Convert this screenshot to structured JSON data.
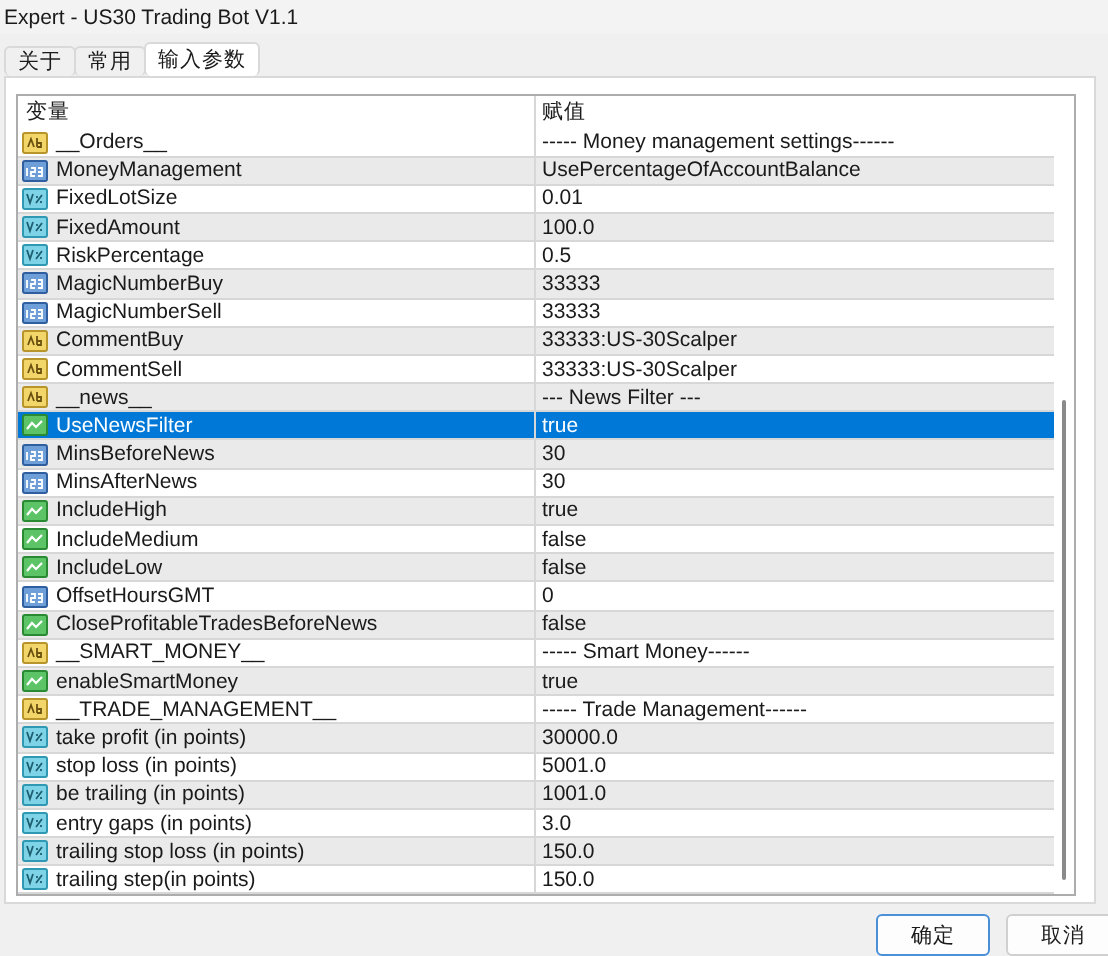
{
  "window": {
    "title": "Expert - US30 Trading Bot V1.1"
  },
  "tabs": [
    {
      "label": "关于",
      "selected": false
    },
    {
      "label": "常用",
      "selected": false
    },
    {
      "label": "输入参数",
      "selected": true
    }
  ],
  "table": {
    "columns": [
      "变量",
      "赋值"
    ],
    "rows": [
      {
        "kind": "string",
        "name": "__Orders__",
        "value": "----- Money management settings------",
        "selected": false
      },
      {
        "kind": "int",
        "name": "MoneyManagement",
        "value": "UsePercentageOfAccountBalance",
        "selected": false
      },
      {
        "kind": "double",
        "name": "FixedLotSize",
        "value": "0.01",
        "selected": false
      },
      {
        "kind": "double",
        "name": "FixedAmount",
        "value": "100.0",
        "selected": false
      },
      {
        "kind": "double",
        "name": "RiskPercentage",
        "value": "0.5",
        "selected": false
      },
      {
        "kind": "int",
        "name": "MagicNumberBuy",
        "value": "33333",
        "selected": false
      },
      {
        "kind": "int",
        "name": "MagicNumberSell",
        "value": "33333",
        "selected": false
      },
      {
        "kind": "string",
        "name": "CommentBuy",
        "value": "33333:US-30Scalper",
        "selected": false
      },
      {
        "kind": "string",
        "name": "CommentSell",
        "value": "33333:US-30Scalper",
        "selected": false
      },
      {
        "kind": "string",
        "name": "__news__",
        "value": "--- News Filter ---",
        "selected": false
      },
      {
        "kind": "bool",
        "name": "UseNewsFilter",
        "value": "true",
        "selected": true
      },
      {
        "kind": "int",
        "name": "MinsBeforeNews",
        "value": "30",
        "selected": false
      },
      {
        "kind": "int",
        "name": "MinsAfterNews",
        "value": "30",
        "selected": false
      },
      {
        "kind": "bool",
        "name": "IncludeHigh",
        "value": "true",
        "selected": false
      },
      {
        "kind": "bool",
        "name": "IncludeMedium",
        "value": "false",
        "selected": false
      },
      {
        "kind": "bool",
        "name": "IncludeLow",
        "value": "false",
        "selected": false
      },
      {
        "kind": "int",
        "name": "OffsetHoursGMT",
        "value": "0",
        "selected": false
      },
      {
        "kind": "bool",
        "name": "CloseProfitableTradesBeforeNews",
        "value": "false",
        "selected": false
      },
      {
        "kind": "string",
        "name": "__SMART_MONEY__",
        "value": "----- Smart Money------",
        "selected": false
      },
      {
        "kind": "bool",
        "name": "enableSmartMoney",
        "value": "true",
        "selected": false
      },
      {
        "kind": "string",
        "name": "__TRADE_MANAGEMENT__",
        "value": "----- Trade Management------",
        "selected": false
      },
      {
        "kind": "double",
        "name": "take profit (in points)",
        "value": "30000.0",
        "selected": false
      },
      {
        "kind": "double",
        "name": "stop loss (in points)",
        "value": "5001.0",
        "selected": false
      },
      {
        "kind": "double",
        "name": "be trailing (in points)",
        "value": "1001.0",
        "selected": false
      },
      {
        "kind": "double",
        "name": "entry gaps (in points)",
        "value": "3.0",
        "selected": false
      },
      {
        "kind": "double",
        "name": "trailing stop loss (in points)",
        "value": "150.0",
        "selected": false
      },
      {
        "kind": "double",
        "name": "trailing step(in points)",
        "value": "150.0",
        "selected": false
      }
    ]
  },
  "buttons": [
    {
      "label": "确定",
      "default": true
    },
    {
      "label": "取消",
      "default": false
    }
  ]
}
